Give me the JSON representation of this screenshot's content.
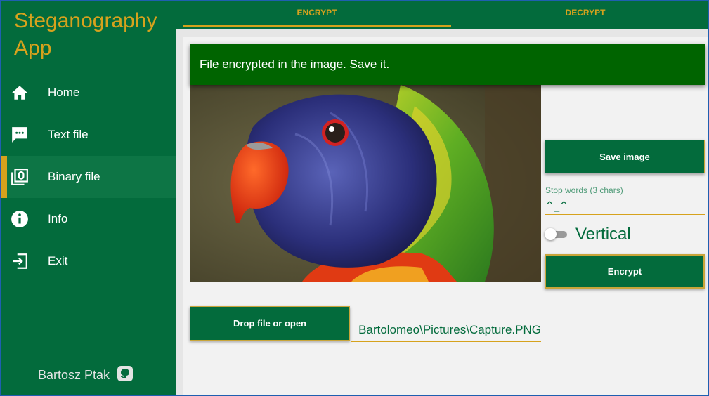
{
  "app": {
    "title": "Steganography App"
  },
  "sidebar": {
    "items": [
      {
        "label": "Home",
        "icon": "home-icon"
      },
      {
        "label": "Text file",
        "icon": "chat-icon"
      },
      {
        "label": "Binary file",
        "icon": "binary-file-icon",
        "active": true
      },
      {
        "label": "Info",
        "icon": "info-icon"
      },
      {
        "label": "Exit",
        "icon": "exit-icon"
      }
    ],
    "author": "Bartosz Ptak",
    "author_icon": "github-icon"
  },
  "tabs": [
    {
      "label": "ENCRYPT",
      "active": true
    },
    {
      "label": "DECRYPT",
      "active": false
    }
  ],
  "notification": "File encrypted in the image. Save it.",
  "controls": {
    "save_label": "Save image",
    "stop_words_label": "Stop words (3 chars)",
    "stop_words_value": "^_^",
    "vertical_label": "Vertical",
    "vertical_on": false,
    "encrypt_label": "Encrypt",
    "open_label": "Drop file or open",
    "file_path": "Bartolomeo\\Pictures\\Capture.PNG"
  },
  "image": {
    "subject": "rainbow-lorikeet-parrot"
  },
  "colors": {
    "primary": "#036b3c",
    "accent": "#d6a21d",
    "notice": "#006400"
  }
}
